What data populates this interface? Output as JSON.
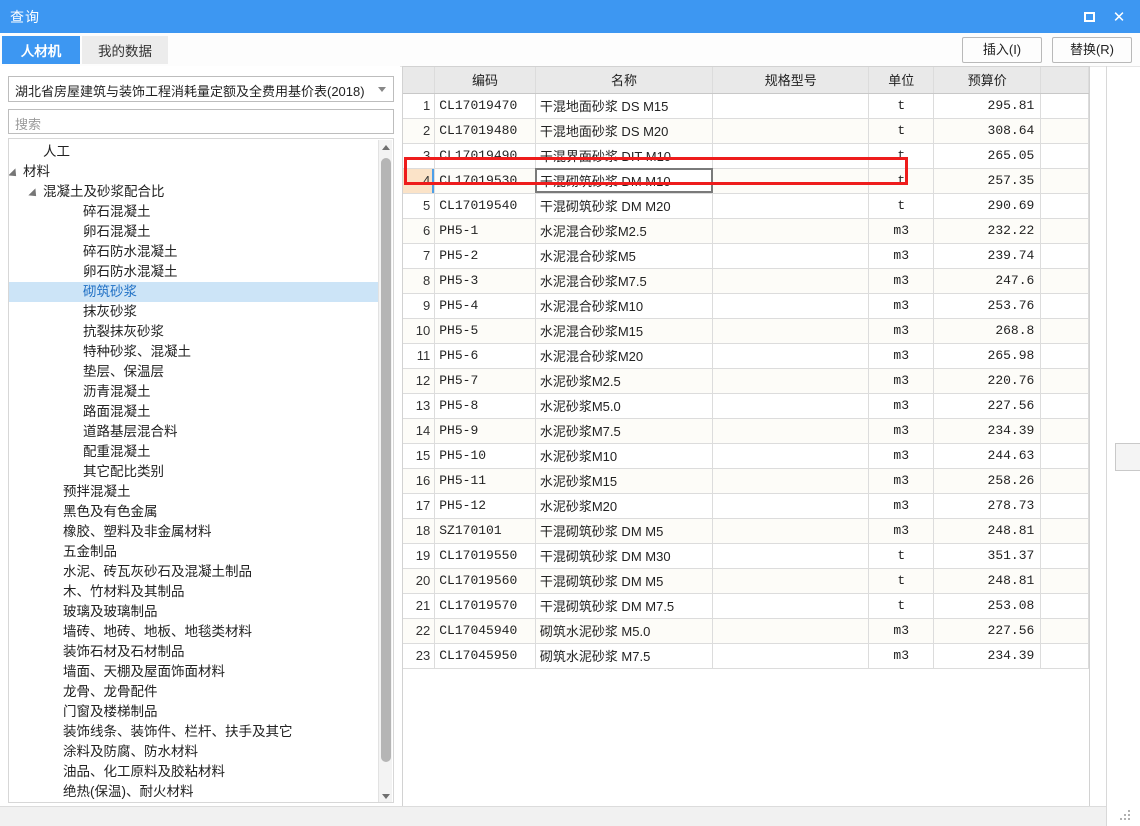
{
  "window": {
    "title": "查询",
    "maximize_icon": "maximize-icon",
    "close_icon": "close-icon",
    "close_glyph": "✕"
  },
  "tabs": [
    {
      "label": "人材机",
      "active": true
    },
    {
      "label": "我的数据",
      "active": false
    }
  ],
  "toolbar": {
    "insert_label": "插入(I)",
    "replace_label": "替换(R)"
  },
  "left": {
    "price_book": {
      "value": "湖北省房屋建筑与装饰工程消耗量定额及全费用基价表(2018)",
      "arrow_icon": "chevron-down-icon"
    },
    "search": {
      "placeholder": "搜索",
      "value": ""
    },
    "tree": [
      {
        "label": "人工",
        "indent": 1,
        "expander": "none",
        "selected": false
      },
      {
        "label": "材料",
        "indent": 0,
        "expander": "expanded",
        "selected": false
      },
      {
        "label": "混凝土及砂浆配合比",
        "indent": 1,
        "expander": "expanded",
        "selected": false
      },
      {
        "label": "碎石混凝土",
        "indent": 3,
        "expander": "none",
        "selected": false
      },
      {
        "label": "卵石混凝土",
        "indent": 3,
        "expander": "none",
        "selected": false
      },
      {
        "label": "碎石防水混凝土",
        "indent": 3,
        "expander": "none",
        "selected": false
      },
      {
        "label": "卵石防水混凝土",
        "indent": 3,
        "expander": "none",
        "selected": false
      },
      {
        "label": "砌筑砂浆",
        "indent": 3,
        "expander": "none",
        "selected": true
      },
      {
        "label": "抹灰砂浆",
        "indent": 3,
        "expander": "none",
        "selected": false
      },
      {
        "label": "抗裂抹灰砂浆",
        "indent": 3,
        "expander": "none",
        "selected": false
      },
      {
        "label": "特种砂浆、混凝土",
        "indent": 3,
        "expander": "none",
        "selected": false
      },
      {
        "label": "垫层、保温层",
        "indent": 3,
        "expander": "none",
        "selected": false
      },
      {
        "label": "沥青混凝土",
        "indent": 3,
        "expander": "none",
        "selected": false
      },
      {
        "label": "路面混凝土",
        "indent": 3,
        "expander": "none",
        "selected": false
      },
      {
        "label": "道路基层混合料",
        "indent": 3,
        "expander": "none",
        "selected": false
      },
      {
        "label": "配重混凝土",
        "indent": 3,
        "expander": "none",
        "selected": false
      },
      {
        "label": "其它配比类别",
        "indent": 3,
        "expander": "none",
        "selected": false
      },
      {
        "label": "预拌混凝土",
        "indent": 2,
        "expander": "none",
        "selected": false
      },
      {
        "label": "黑色及有色金属",
        "indent": 2,
        "expander": "none",
        "selected": false
      },
      {
        "label": "橡胶、塑料及非金属材料",
        "indent": 2,
        "expander": "none",
        "selected": false
      },
      {
        "label": "五金制品",
        "indent": 2,
        "expander": "none",
        "selected": false
      },
      {
        "label": "水泥、砖瓦灰砂石及混凝土制品",
        "indent": 2,
        "expander": "none",
        "selected": false
      },
      {
        "label": "木、竹材料及其制品",
        "indent": 2,
        "expander": "none",
        "selected": false
      },
      {
        "label": "玻璃及玻璃制品",
        "indent": 2,
        "expander": "none",
        "selected": false
      },
      {
        "label": "墙砖、地砖、地板、地毯类材料",
        "indent": 2,
        "expander": "none",
        "selected": false
      },
      {
        "label": "装饰石材及石材制品",
        "indent": 2,
        "expander": "none",
        "selected": false
      },
      {
        "label": "墙面、天棚及屋面饰面材料",
        "indent": 2,
        "expander": "none",
        "selected": false
      },
      {
        "label": "龙骨、龙骨配件",
        "indent": 2,
        "expander": "none",
        "selected": false
      },
      {
        "label": "门窗及楼梯制品",
        "indent": 2,
        "expander": "none",
        "selected": false
      },
      {
        "label": "装饰线条、装饰件、栏杆、扶手及其它",
        "indent": 2,
        "expander": "none",
        "selected": false
      },
      {
        "label": "涂料及防腐、防水材料",
        "indent": 2,
        "expander": "none",
        "selected": false
      },
      {
        "label": "油品、化工原料及胶粘材料",
        "indent": 2,
        "expander": "none",
        "selected": false
      },
      {
        "label": "绝热(保温)、耐火材料",
        "indent": 2,
        "expander": "none",
        "selected": false
      }
    ],
    "scrollbar": {
      "up_icon": "scroll-up-icon",
      "down_icon": "scroll-down-icon"
    }
  },
  "table": {
    "columns": [
      "",
      "编码",
      "名称",
      "规格型号",
      "单位",
      "预算价"
    ],
    "selected_row_index": 4,
    "rows": [
      {
        "n": "1",
        "code": "CL17019470",
        "name": "干混地面砂浆 DS M15",
        "spec": "",
        "unit": "t",
        "price": "295.81"
      },
      {
        "n": "2",
        "code": "CL17019480",
        "name": "干混地面砂浆 DS M20",
        "spec": "",
        "unit": "t",
        "price": "308.64"
      },
      {
        "n": "3",
        "code": "CL17019490",
        "name": "干混界面砂浆 DIT M10",
        "spec": "",
        "unit": "t",
        "price": "265.05"
      },
      {
        "n": "4",
        "code": "CL17019530",
        "name": "干混砌筑砂浆 DM M10",
        "spec": "",
        "unit": "t",
        "price": "257.35"
      },
      {
        "n": "5",
        "code": "CL17019540",
        "name": "干混砌筑砂浆 DM M20",
        "spec": "",
        "unit": "t",
        "price": "290.69"
      },
      {
        "n": "6",
        "code": "PH5-1",
        "name": "水泥混合砂浆M2.5",
        "spec": "",
        "unit": "m3",
        "price": "232.22"
      },
      {
        "n": "7",
        "code": "PH5-2",
        "name": "水泥混合砂浆M5",
        "spec": "",
        "unit": "m3",
        "price": "239.74"
      },
      {
        "n": "8",
        "code": "PH5-3",
        "name": "水泥混合砂浆M7.5",
        "spec": "",
        "unit": "m3",
        "price": "247.6"
      },
      {
        "n": "9",
        "code": "PH5-4",
        "name": "水泥混合砂浆M10",
        "spec": "",
        "unit": "m3",
        "price": "253.76"
      },
      {
        "n": "10",
        "code": "PH5-5",
        "name": "水泥混合砂浆M15",
        "spec": "",
        "unit": "m3",
        "price": "268.8"
      },
      {
        "n": "11",
        "code": "PH5-6",
        "name": "水泥混合砂浆M20",
        "spec": "",
        "unit": "m3",
        "price": "265.98"
      },
      {
        "n": "12",
        "code": "PH5-7",
        "name": "水泥砂浆M2.5",
        "spec": "",
        "unit": "m3",
        "price": "220.76"
      },
      {
        "n": "13",
        "code": "PH5-8",
        "name": "水泥砂浆M5.0",
        "spec": "",
        "unit": "m3",
        "price": "227.56"
      },
      {
        "n": "14",
        "code": "PH5-9",
        "name": "水泥砂浆M7.5",
        "spec": "",
        "unit": "m3",
        "price": "234.39"
      },
      {
        "n": "15",
        "code": "PH5-10",
        "name": "水泥砂浆M10",
        "spec": "",
        "unit": "m3",
        "price": "244.63"
      },
      {
        "n": "16",
        "code": "PH5-11",
        "name": "水泥砂浆M15",
        "spec": "",
        "unit": "m3",
        "price": "258.26"
      },
      {
        "n": "17",
        "code": "PH5-12",
        "name": "水泥砂浆M20",
        "spec": "",
        "unit": "m3",
        "price": "278.73"
      },
      {
        "n": "18",
        "code": "SZ170101",
        "name": "干混砌筑砂浆 DM M5",
        "spec": "",
        "unit": "m3",
        "price": "248.81"
      },
      {
        "n": "19",
        "code": "CL17019550",
        "name": "干混砌筑砂浆 DM M30",
        "spec": "",
        "unit": "t",
        "price": "351.37"
      },
      {
        "n": "20",
        "code": "CL17019560",
        "name": "干混砌筑砂浆 DM M5",
        "spec": "",
        "unit": "t",
        "price": "248.81"
      },
      {
        "n": "21",
        "code": "CL17019570",
        "name": "干混砌筑砂浆 DM M7.5",
        "spec": "",
        "unit": "t",
        "price": "253.08"
      },
      {
        "n": "22",
        "code": "CL17045940",
        "name": "砌筑水泥砂浆 M5.0",
        "spec": "",
        "unit": "m3",
        "price": "227.56"
      },
      {
        "n": "23",
        "code": "CL17045950",
        "name": "砌筑水泥砂浆 M7.5",
        "spec": "",
        "unit": "m3",
        "price": "234.39"
      }
    ]
  },
  "colors": {
    "accent": "#3d97f2",
    "annotation": "#ee1c1c",
    "header_highlight": "#fce0c0",
    "tree_selection": "#cce4f7"
  }
}
